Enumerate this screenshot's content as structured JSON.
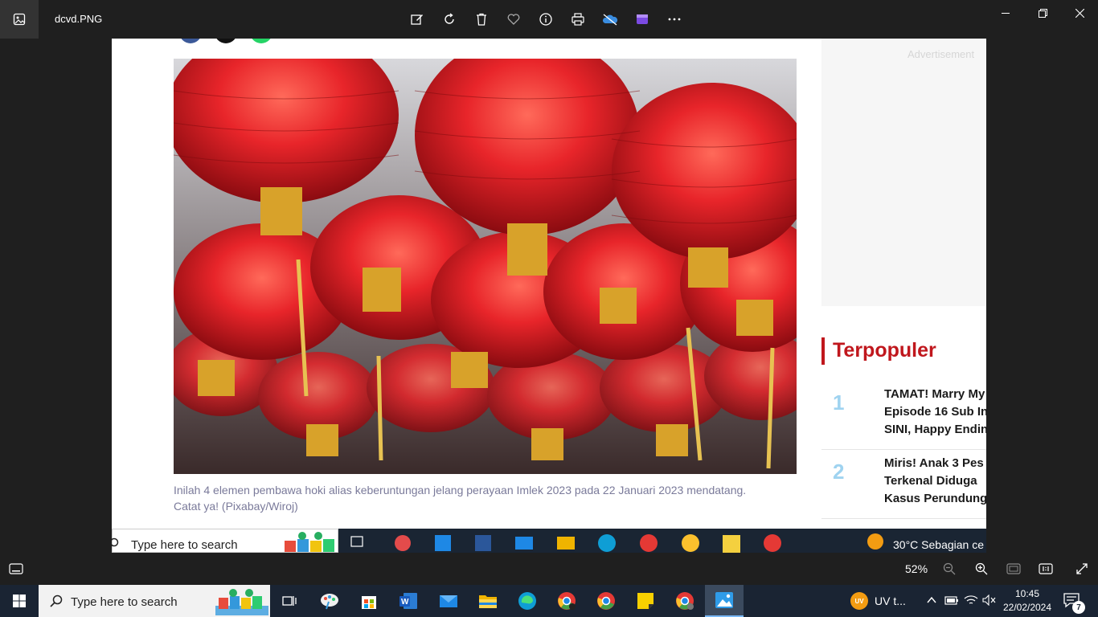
{
  "app": {
    "filename": "dcvd.PNG",
    "toolbar_icons": [
      "edit-icon",
      "rotate-icon",
      "delete-icon",
      "favorite-icon",
      "info-icon",
      "print-icon",
      "onedrive-icon",
      "clipchamp-icon",
      "more-icon"
    ],
    "window_controls": [
      "minimize-icon",
      "restore-icon",
      "close-icon"
    ]
  },
  "article": {
    "caption": "Inilah 4 elemen pembawa hoki alias keberuntungan jelang perayaan Imlek 2023 pada 22 Januari 2023 mendatang. Catat ya! (Pixabay/Wiroj)",
    "advertisement_label": "Advertisement",
    "sidebar_title": "Terpopuler",
    "popular": [
      {
        "num": "1",
        "lines": [
          "TAMAT! Marry My",
          "Episode 16 Sub In",
          "SINI, Happy Endin"
        ]
      },
      {
        "num": "2",
        "lines": [
          "Miris! Anak 3 Pes",
          "Terkenal Diduga",
          "Kasus Perundung"
        ]
      }
    ],
    "social_colors": [
      "#3b5998",
      "#111111",
      "#25d366"
    ]
  },
  "inner_taskbar": {
    "search_placeholder": "Type here to search",
    "weather": "30°C  Sebagian ce"
  },
  "viewer_bar": {
    "zoom": "52%"
  },
  "taskbar": {
    "search_placeholder": "Type here to search",
    "uv_badge": "UV",
    "uv_label": "UV t...",
    "time": "10:45",
    "date": "22/02/2024",
    "notification_count": "7"
  },
  "colors": {
    "accent_red": "#c0171d",
    "taskbar_bg": "#1a2433",
    "chrome_bg": "#1f1f1f"
  }
}
